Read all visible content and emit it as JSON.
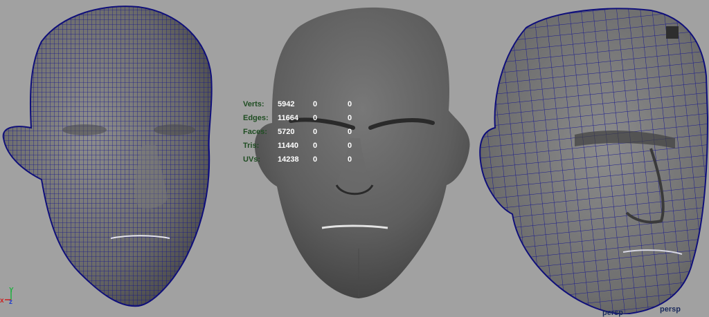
{
  "poly_count_hud": {
    "rows": [
      {
        "label": "Verts:",
        "values": [
          "5942",
          "0",
          "0"
        ]
      },
      {
        "label": "Edges:",
        "values": [
          "11664",
          "0",
          "0"
        ]
      },
      {
        "label": "Faces:",
        "values": [
          "5720",
          "0",
          "0"
        ]
      },
      {
        "label": "Tris:",
        "values": [
          "11440",
          "0",
          "0"
        ]
      },
      {
        "label": "UVs:",
        "values": [
          "14238",
          "0",
          "0"
        ]
      }
    ]
  },
  "axis_indicator": {
    "x": "x",
    "y": "Y",
    "z": "z"
  },
  "camera_labels": [
    "persp",
    "persp"
  ],
  "colors": {
    "background": "#a1a1a1",
    "wireframe": "#101080",
    "hud_label": "#1f4d22",
    "hud_value": "#ffffff",
    "axis_x": "#cc2020",
    "axis_y": "#20b040",
    "axis_z": "#2040cc"
  }
}
